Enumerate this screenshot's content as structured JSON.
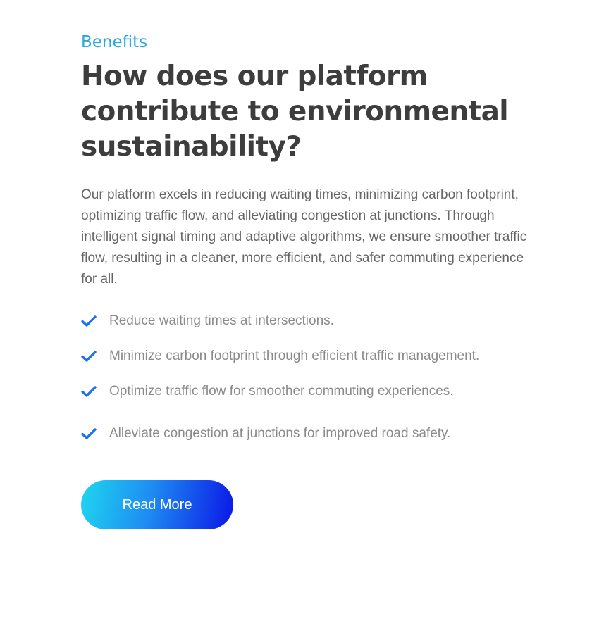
{
  "section": {
    "eyebrow": "Benefits",
    "title": "How does our platform contribute to environmental sustainability?",
    "description": "Our platform excels in reducing waiting times, minimizing carbon footprint, optimizing traffic flow, and alleviating congestion at junctions. Through intelligent signal timing and adaptive algorithms, we ensure smoother traffic flow, resulting in a cleaner, more efficient, and safer commuting experience for all.",
    "benefits": [
      {
        "icon": "check-icon",
        "text": "Reduce waiting times at intersections."
      },
      {
        "icon": "check-icon",
        "text": "Minimize carbon footprint through efficient traffic management."
      },
      {
        "icon": "check-icon",
        "text": "Optimize traffic flow for smoother commuting experiences."
      },
      {
        "icon": "check-icon",
        "text": "Alleviate congestion at junctions for improved road safety."
      }
    ],
    "cta_label": "Read More"
  },
  "colors": {
    "eyebrow": "#29a8e0",
    "heading": "#3d3d3d",
    "body_text": "#666666",
    "list_text": "#8a8a8a",
    "check": "#1a73e8",
    "button_gradient_start": "#1fd6ef",
    "button_gradient_end": "#0b16e6",
    "button_text": "#ffffff"
  }
}
